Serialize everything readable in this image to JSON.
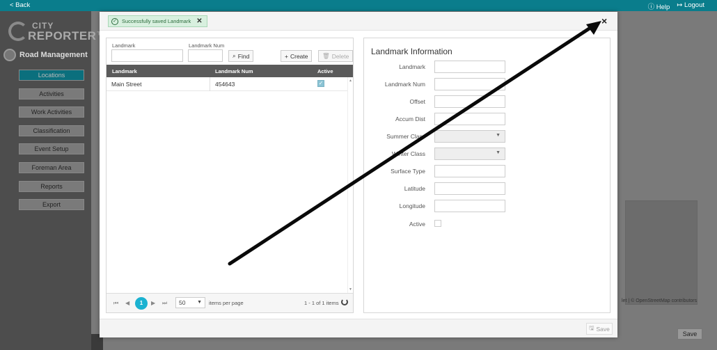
{
  "topbar": {
    "back": "< Back",
    "help": "Help",
    "logout": "Logout",
    "help_icon": "question-circle-icon",
    "logout_icon": "logout-icon"
  },
  "sidebar": {
    "logo_city": "CITY",
    "logo_reporter": "REPORTER™",
    "module_title": "Road Management",
    "items": [
      {
        "label": "Locations",
        "active": true
      },
      {
        "label": "Activities"
      },
      {
        "label": "Work Activities"
      },
      {
        "label": "Classification"
      },
      {
        "label": "Event Setup"
      },
      {
        "label": "Foreman Area"
      },
      {
        "label": "Reports"
      },
      {
        "label": "Export"
      }
    ]
  },
  "background": {
    "map_attribution": "let | © OpenStreetMap contributors",
    "save_label": "Save"
  },
  "modal": {
    "toast": "Successfully saved Landmark",
    "close": "×",
    "search": {
      "landmark_label": "Landmark",
      "landmark_value": "",
      "num_label": "Landmark Num",
      "num_value": "",
      "find": "Find",
      "create": "Create",
      "delete": "Delete"
    },
    "grid": {
      "columns": [
        "Landmark",
        "Landmark Num",
        "Active"
      ],
      "rows": [
        {
          "landmark": "Main Street",
          "num": "454643",
          "active": true
        }
      ]
    },
    "pager": {
      "current_page": "1",
      "page_size": "50",
      "items_per_page": "items per page",
      "summary": "1 - 1 of 1 items"
    },
    "info": {
      "title": "Landmark Information",
      "fields": [
        {
          "label": "Landmark",
          "type": "text"
        },
        {
          "label": "Landmark Num",
          "type": "text"
        },
        {
          "label": "Offset",
          "type": "text"
        },
        {
          "label": "Accum Dist",
          "type": "text"
        },
        {
          "label": "Summer Class",
          "type": "select"
        },
        {
          "label": "Winter Class",
          "type": "select"
        },
        {
          "label": "Surface Type",
          "type": "text"
        },
        {
          "label": "Latitude",
          "type": "text"
        },
        {
          "label": "Longitude",
          "type": "text"
        },
        {
          "label": "Active",
          "type": "checkbox"
        }
      ]
    },
    "save": "Save"
  },
  "colors": {
    "accent": "#0a7d8c",
    "primary_pager": "#1bb2d1",
    "toast_bg": "#d8f0df",
    "grid_header": "#5a5a5a"
  }
}
